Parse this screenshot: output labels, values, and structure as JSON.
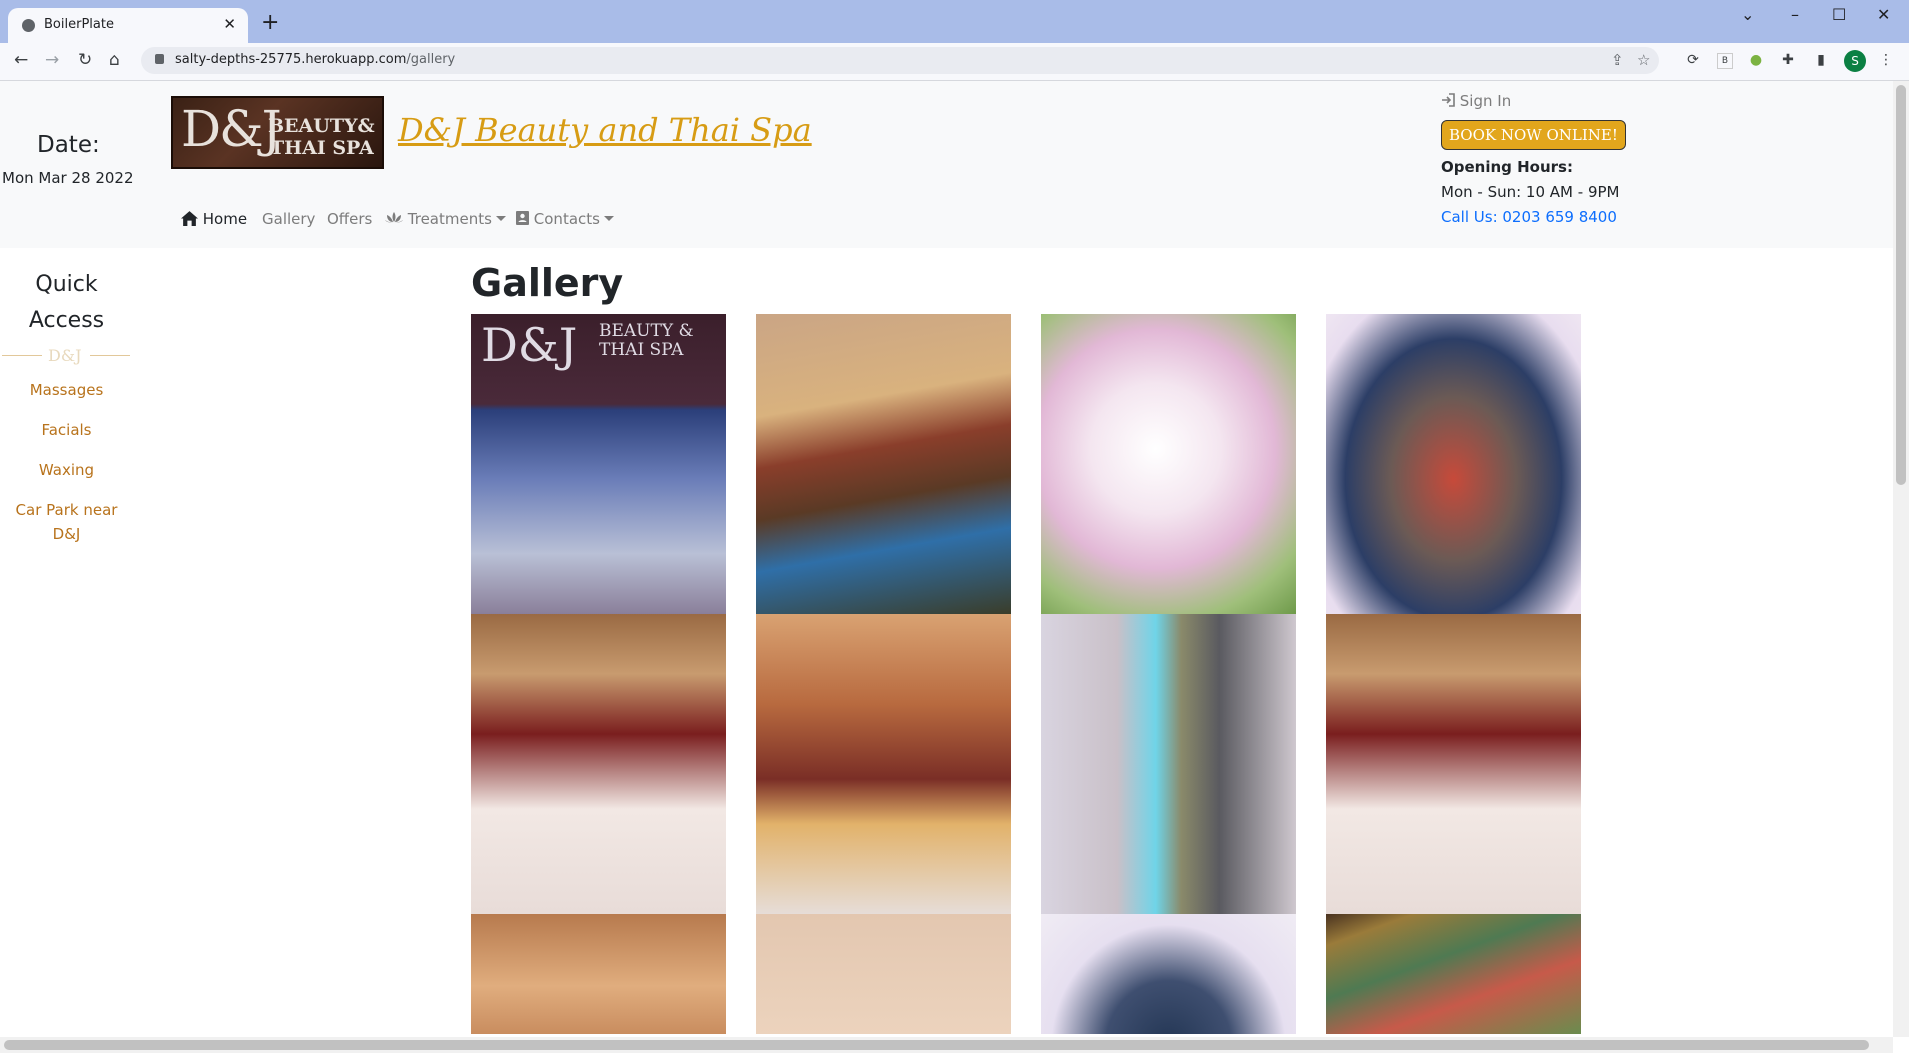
{
  "browser": {
    "tab_title": "BoilerPlate",
    "url_host": "salty-depths-25775.herokuapp.com",
    "url_path": "/gallery",
    "profile_initial": "S"
  },
  "header": {
    "date_label": "Date:",
    "date_value": "Mon Mar 28 2022",
    "logo": {
      "main": "D&J",
      "line1": "BEAUTY&",
      "line2": "THAI SPA"
    },
    "brand_title": " D&J Beauty and Thai Spa",
    "nav": [
      {
        "label": "Home",
        "icon": "home-icon"
      },
      {
        "label": "Gallery"
      },
      {
        "label": "Offers"
      },
      {
        "label": "Treatments",
        "icon": "lotus-icon"
      },
      {
        "label": "Contacts",
        "icon": "contact-card-icon"
      }
    ],
    "sign_in": "Sign In",
    "book_button": "BOOK NOW ONLINE!",
    "hours_title": "Opening Hours:",
    "hours_value": "Mon - Sun: 10 AM - 9PM",
    "phone": "Call Us: 0203 659 8400"
  },
  "sidebar": {
    "title": "Quick Access",
    "divider_text": "D&J",
    "links": [
      "Massages",
      "Facials",
      "Waxing",
      "Car Park near D&J"
    ]
  },
  "main": {
    "title": "Gallery",
    "images": [
      {
        "name": "shopfront-photo"
      },
      {
        "name": "treatment-room-photo"
      },
      {
        "name": "orchid-flower-photo"
      },
      {
        "name": "buddha-decor-bowl-photo"
      },
      {
        "name": "massage-bed-candles-photo"
      },
      {
        "name": "towels-buddha-candles-photo"
      },
      {
        "name": "hallway-photo"
      },
      {
        "name": "massage-bed-flower-photo"
      },
      {
        "name": "candle-wall-photo"
      },
      {
        "name": "clock-wall-photo"
      },
      {
        "name": "decor-bowl-photo"
      },
      {
        "name": "thai-painting-photo"
      }
    ]
  },
  "colors": {
    "accent": "#d79c14",
    "book_button": "#e2a61c",
    "link_phone": "#0d6efd",
    "sidebar_link": "#b8731c"
  }
}
